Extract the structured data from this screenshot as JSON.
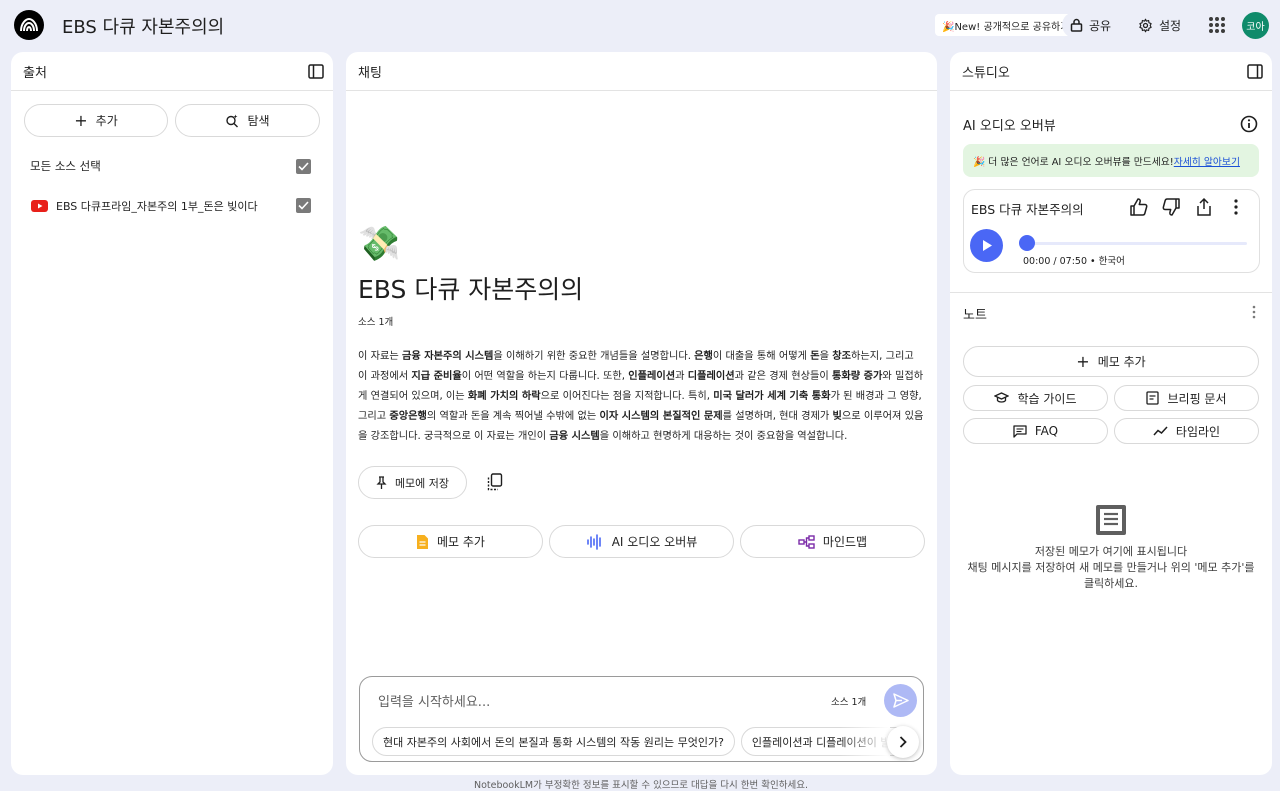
{
  "header": {
    "title": "EBS 다큐 자본주의의",
    "new_badge": "🎉New! 공개적으로 공유하기",
    "share_label": "공유",
    "settings_label": "설정",
    "avatar_text": "코아"
  },
  "sources": {
    "title": "출처",
    "add_label": "추가",
    "explore_label": "탐색",
    "select_all_label": "모든 소스 선택",
    "items": [
      {
        "label": "EBS 다큐프라임_자본주의 1부_돈은 빚이다",
        "checked": true
      }
    ]
  },
  "chat": {
    "title": "채팅",
    "emoji": "💸",
    "notebook_title": "EBS 다큐 자본주의의",
    "source_count": "소스 1개",
    "summary_parts": [
      {
        "t": "이 자료는 "
      },
      {
        "t": "금융 자본주의 시스템",
        "b": true
      },
      {
        "t": "을 이해하기 위한 중요한 개념들을 설명합니다. "
      },
      {
        "t": "은행",
        "b": true
      },
      {
        "t": "이 대출을 통해 어떻게 "
      },
      {
        "t": "돈",
        "b": true
      },
      {
        "t": "을 "
      },
      {
        "t": "창조",
        "b": true
      },
      {
        "t": "하는지, 그리고 이 과정에서 "
      },
      {
        "t": "지급 준비율",
        "b": true
      },
      {
        "t": "이 어떤 역할을 하는지 다룹니다. 또한, "
      },
      {
        "t": "인플레이션",
        "b": true
      },
      {
        "t": "과 "
      },
      {
        "t": "디플레이션",
        "b": true
      },
      {
        "t": "과 같은 경제 현상들이 "
      },
      {
        "t": "통화량 증가",
        "b": true
      },
      {
        "t": "와 밀접하게 연결되어 있으며, 이는 "
      },
      {
        "t": "화폐 가치의 하락",
        "b": true
      },
      {
        "t": "으로 이어진다는 점을 지적합니다. 특히, "
      },
      {
        "t": "미국 달러가 세계 기축 통화",
        "b": true
      },
      {
        "t": "가 된 배경과 그 영향, 그리고 "
      },
      {
        "t": "중앙은행",
        "b": true
      },
      {
        "t": "의 역할과 돈을 계속 찍어낼 수밖에 없는 "
      },
      {
        "t": "이자 시스템의 본질적인 문제",
        "b": true
      },
      {
        "t": "를 설명하며, 현대 경제가 "
      },
      {
        "t": "빚",
        "b": true
      },
      {
        "t": "으로 이루어져 있음을 강조합니다. 궁극적으로 이 자료는 개인이 "
      },
      {
        "t": "금융 시스템",
        "b": true
      },
      {
        "t": "을 이해하고 현명하게 대응하는 것이 중요함을 역설합니다."
      }
    ],
    "save_to_note_label": "메모에 저장",
    "actions": {
      "add_note": "메모 추가",
      "audio_overview": "AI 오디오 오버뷰",
      "mind_map": "마인드맵"
    },
    "input_placeholder": "입력을 시작하세요...",
    "input_source_count": "소스 1개",
    "suggestions": [
      "현대 자본주의 사회에서 돈의 본질과 통화 시스템의 작동 원리는 무엇인가?",
      "인플레이션과 디플레이션이 발생하"
    ]
  },
  "studio": {
    "title": "스튜디오",
    "audio_section_title": "AI 오디오 오버뷰",
    "banner_text": "🎉 더 많은 언어로 AI 오디오 오버뷰를 만드세요!",
    "banner_link": "자세히 알아보기",
    "player_title": "EBS 다큐 자본주의의",
    "player_time": "00:00 / 07:50 • 한국어",
    "player_progress": 0,
    "notes_title": "노트",
    "add_note_label": "메모 추가",
    "study_guide_label": "학습 가이드",
    "briefing_label": "브리핑 문서",
    "faq_label": "FAQ",
    "timeline_label": "타임라인",
    "empty_title": "저장된 메모가 여기에 표시됩니다",
    "empty_desc": "채팅 메시지를 저장하여 새 메모를 만들거나 위의 '메모 추가'를 클릭하세요."
  },
  "footer": {
    "disclaimer": "NotebookLM가 부정확한 정보를 표시할 수 있으므로 대답을 다시 한번 확인하세요."
  },
  "colors": {
    "accent": "#4a67f5",
    "send_disabled": "#aeb9f5",
    "banner_bg": "#e3f5e1",
    "youtube": "#e8201a",
    "avatar": "#0f8b6b"
  }
}
